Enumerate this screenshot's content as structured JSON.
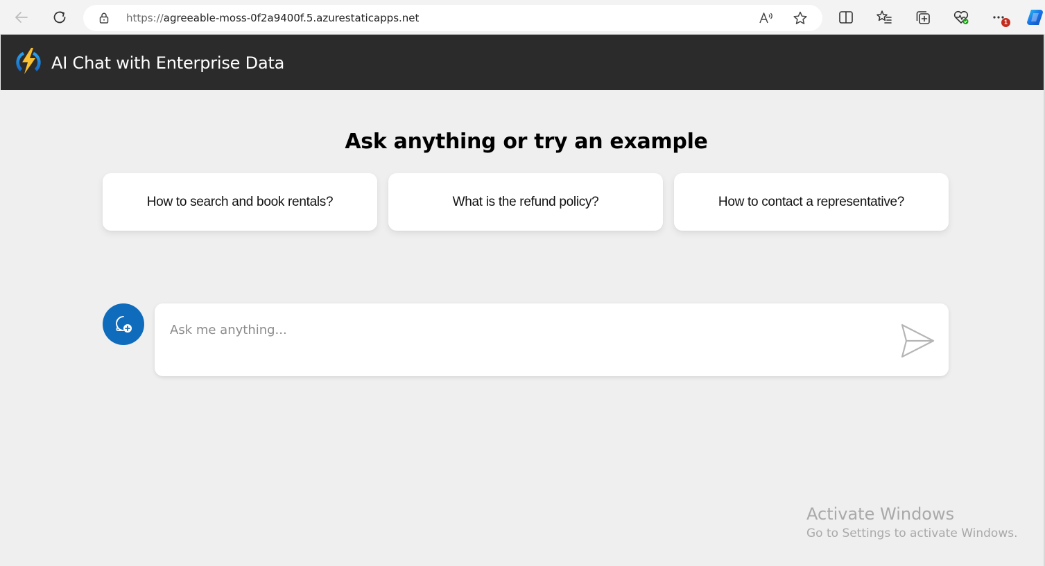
{
  "browser": {
    "url_protocol": "https://",
    "url_host": "agreeable-moss-0f2a9400f.5.azurestaticapps.net",
    "notification_count": "1",
    "icons": [
      "back-arrow-icon",
      "refresh-icon",
      "lock-icon",
      "read-aloud-icon",
      "favorite-star-icon",
      "split-screen-icon",
      "favorites-list-icon",
      "collections-icon",
      "browser-essentials-icon",
      "more-icon",
      "copilot-icon"
    ]
  },
  "header": {
    "title": "AI Chat with Enterprise Data",
    "logo": "lightning-bolt-logo"
  },
  "main": {
    "heading": "Ask anything or try an example",
    "examples": [
      {
        "label": "How to search and book rentals?"
      },
      {
        "label": "What is the refund policy?"
      },
      {
        "label": "How to contact a representative?"
      }
    ],
    "chat": {
      "placeholder": "Ask me anything...",
      "new_chat_icon": "chat-add-icon",
      "send_icon": "send-icon"
    }
  },
  "watermark": {
    "title": "Activate Windows",
    "subtitle": "Go to Settings to activate Windows."
  },
  "colors": {
    "header_bg": "#2b2b2b",
    "page_bg": "#efefef",
    "accent": "#0f6cbd"
  }
}
